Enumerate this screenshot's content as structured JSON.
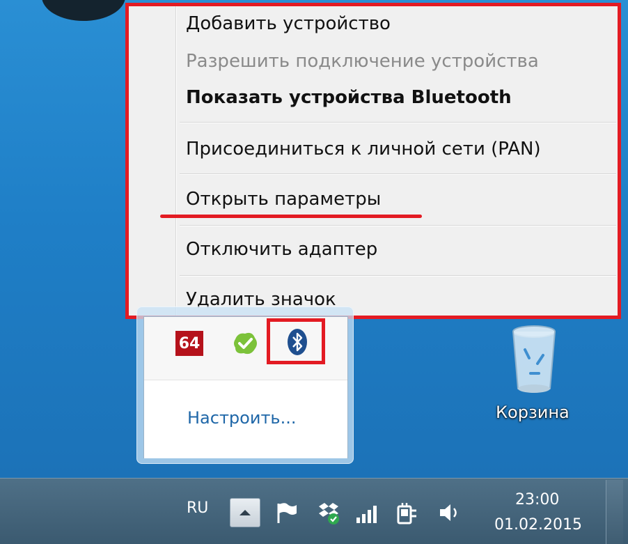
{
  "context_menu": {
    "items": [
      {
        "label": "Добавить устройство",
        "state": "normal"
      },
      {
        "label": "Разрешить подключение устройства",
        "state": "disabled"
      },
      {
        "label": "Показать устройства Bluetooth",
        "state": "default-bold"
      },
      {
        "label": "Присоединиться к личной сети (PAN)",
        "state": "normal"
      },
      {
        "label": "Открыть параметры",
        "state": "highlighted-underline"
      },
      {
        "label": "Отключить адаптер",
        "state": "normal"
      },
      {
        "label": "Удалить значок",
        "state": "normal"
      }
    ],
    "highlight_color": "#e31b23"
  },
  "tray_popup": {
    "icons": [
      {
        "name": "app-64-icon",
        "text": "64"
      },
      {
        "name": "green-check-icon"
      },
      {
        "name": "bluetooth-icon"
      }
    ],
    "customize_link": "Настроить..."
  },
  "desktop": {
    "recycle_bin_label": "Корзина"
  },
  "taskbar": {
    "language": "RU",
    "clock": {
      "time": "23:00",
      "date": "01.02.2015"
    },
    "tray_icons": [
      "flag-icon",
      "dropbox-sync-icon",
      "signal-bars-icon",
      "power-plug-icon",
      "speaker-icon"
    ]
  }
}
